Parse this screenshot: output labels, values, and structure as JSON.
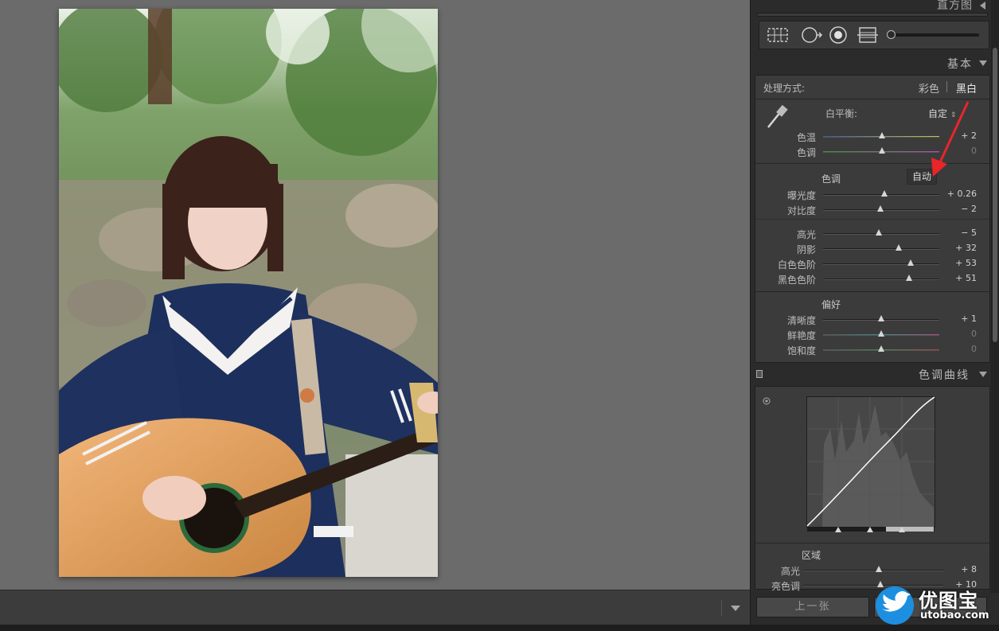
{
  "panels": {
    "histogram": {
      "title": "直方图"
    },
    "basic": {
      "title": "基本",
      "treatment": {
        "label": "处理方式:",
        "color_option": "彩色",
        "bw_option": "黑白"
      },
      "white_balance": {
        "label": "白平衡:",
        "value": "自定"
      },
      "wb_sliders": [
        {
          "label": "色温",
          "value": "+ 2",
          "pos": 0.51
        },
        {
          "label": "色调",
          "value": "0",
          "pos": 0.51
        }
      ],
      "tone_title": "色调",
      "auto_button": "自动",
      "tone_sliders": [
        {
          "label": "曝光度",
          "value": "+ 0.26",
          "pos": 0.53
        },
        {
          "label": "对比度",
          "value": "− 2",
          "pos": 0.49
        }
      ],
      "tone_sliders_2": [
        {
          "label": "高光",
          "value": "− 5",
          "pos": 0.48
        },
        {
          "label": "阴影",
          "value": "+ 32",
          "pos": 0.65
        },
        {
          "label": "白色色阶",
          "value": "+ 53",
          "pos": 0.75
        },
        {
          "label": "黑色色阶",
          "value": "+ 51",
          "pos": 0.74
        }
      ],
      "presence_title": "偏好",
      "presence_sliders": [
        {
          "label": "清晰度",
          "value": "+ 1",
          "pos": 0.5
        },
        {
          "label": "鲜艳度",
          "value": "0",
          "pos": 0.5
        },
        {
          "label": "饱和度",
          "value": "0",
          "pos": 0.5
        }
      ]
    },
    "tone_curve": {
      "title": "色调曲线",
      "region_title": "区域",
      "region_sliders": [
        {
          "label": "高光",
          "value": "+ 8",
          "pos": 0.54
        },
        {
          "label": "亮色调",
          "value": "+ 10",
          "pos": 0.55
        }
      ]
    }
  },
  "nav": {
    "prev_button": "上一张"
  },
  "watermark": {
    "text": "优图宝",
    "domain": "utobao.com"
  },
  "colors": {
    "accent_arrow": "#e8262a",
    "panel_bg": "#3b3b3b"
  }
}
